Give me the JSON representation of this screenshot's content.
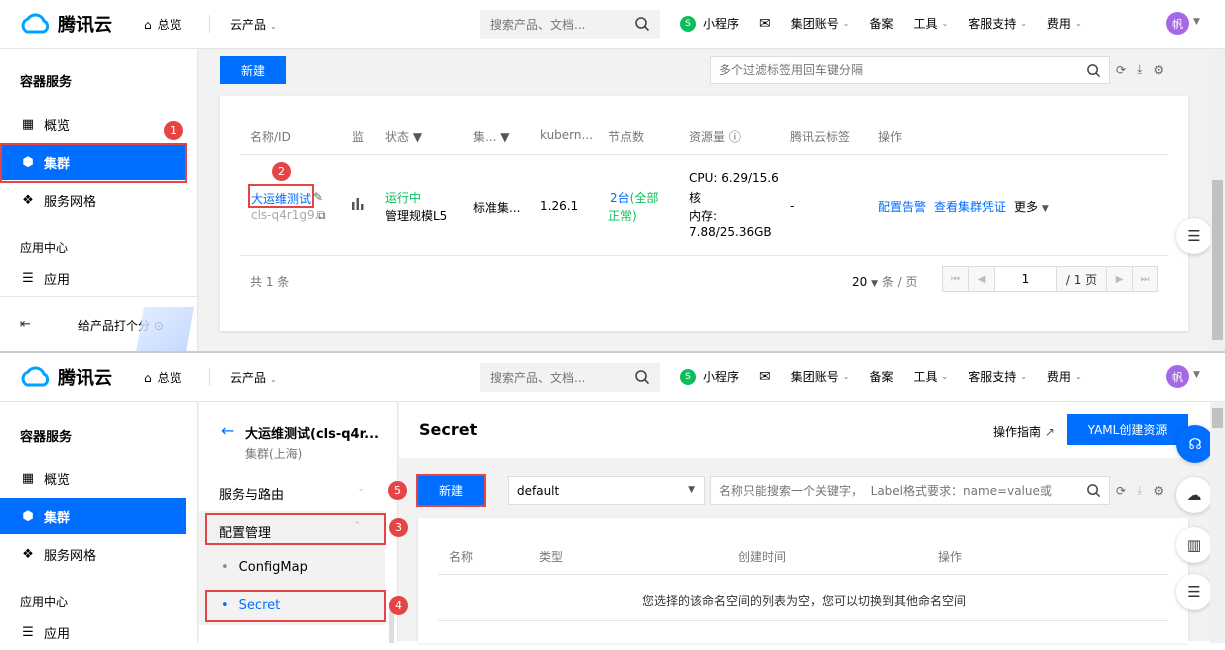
{
  "brand": {
    "name": "腾讯云"
  },
  "nav": {
    "home": "总览",
    "products": "云产品",
    "search_placeholder": "搜索产品、文档...",
    "items": [
      "小程序",
      "集团账号",
      "备案",
      "工具",
      "客服支持",
      "费用"
    ],
    "avatar": "帆"
  },
  "sidebar": {
    "title": "容器服务",
    "items": [
      "概览",
      "集群",
      "服务网格"
    ],
    "group": "应用中心",
    "app": "应用",
    "rate": "给产品打个分"
  },
  "panel1": {
    "new_button": "新建",
    "filter_placeholder": "多个过滤标签用回车键分隔",
    "columns": [
      "名称/ID",
      "监",
      "状态",
      "集...",
      "kubern...",
      "节点数",
      "资源量",
      "腾讯云标签",
      "操作"
    ],
    "row": {
      "name": "大运维测试",
      "id": "cls-q4r1g9...",
      "status": "运行中",
      "scale": "管理规模L5",
      "type": "标准集...",
      "version": "1.26.1",
      "nodes_count": "2台",
      "nodes_status_open": "(全部",
      "nodes_status_close": "正常)",
      "cpu_line1": "CPU: 6.29/15.6",
      "cpu_line2": "核",
      "mem_line1": "内存:",
      "mem_line2": "7.88/25.36GB",
      "tag": "-",
      "actions": [
        "配置告警",
        "查看集群凭证",
        "更多"
      ]
    },
    "total": "共 1 条",
    "page_size": "20",
    "page_size_unit": "条 / 页",
    "current_page": "1",
    "total_pages": "/ 1 页"
  },
  "panel2": {
    "cluster_name": "大运维测试(cls-q4r...",
    "cluster_region": "集群(上海)",
    "menu": {
      "service_route": "服务与路由",
      "config": "配置管理",
      "configmap": "ConfigMap",
      "secret": "Secret"
    },
    "page_title": "Secret",
    "guide": "操作指南",
    "yaml_button": "YAML创建资源",
    "new_button": "新建",
    "namespace": "default",
    "filter_placeholder": "名称只能搜索一个关键字，  Label格式要求：name=value或",
    "columns": [
      "名称",
      "类型",
      "创建时间",
      "操作"
    ],
    "empty": "您选择的该命名空间的列表为空，您可以切换到其他命名空间"
  },
  "annotations": [
    "1",
    "2",
    "3",
    "4",
    "5"
  ],
  "colors": {
    "primary": "#006eff",
    "accent_red": "#e54545",
    "success": "#0abf5b"
  }
}
